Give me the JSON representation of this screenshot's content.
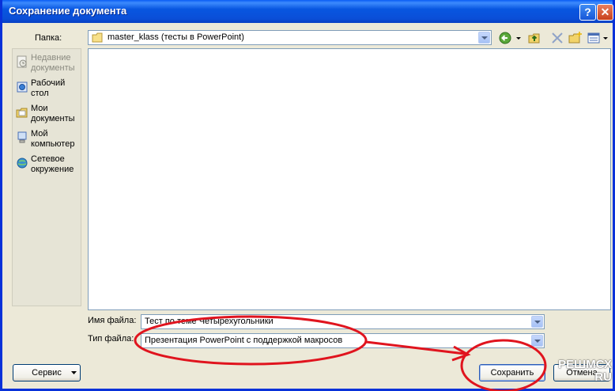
{
  "window": {
    "title": "Сохранение документа",
    "help_glyph": "?",
    "close_glyph": "✕"
  },
  "folder": {
    "label": "Папка:",
    "value": "master_klass (тесты в PowerPoint)"
  },
  "places": [
    {
      "label": "Недавние документы",
      "icon": "recent-docs-icon",
      "disabled": true
    },
    {
      "label": "Рабочий стол",
      "icon": "desktop-icon",
      "disabled": false
    },
    {
      "label": "Мои документы",
      "icon": "my-documents-icon",
      "disabled": false
    },
    {
      "label": "Мой компьютер",
      "icon": "my-computer-icon",
      "disabled": false
    },
    {
      "label": "Сетевое окружение",
      "icon": "network-icon",
      "disabled": false
    }
  ],
  "filename": {
    "label": "Имя файла:",
    "value": "Тест по теме Четырехугольники"
  },
  "filetype": {
    "label": "Тип файла:",
    "value": "Презентация PowerPoint с поддержкой макросов"
  },
  "buttons": {
    "service": "Сервис",
    "save": "Сохранить",
    "cancel": "Отмена"
  },
  "watermark": {
    "line1": "РЕШМСХ",
    "line2": "RU"
  },
  "colors": {
    "titlebar": "#0a5cf5",
    "dialog": "#ece9d8",
    "annotation": "#e0141e"
  }
}
